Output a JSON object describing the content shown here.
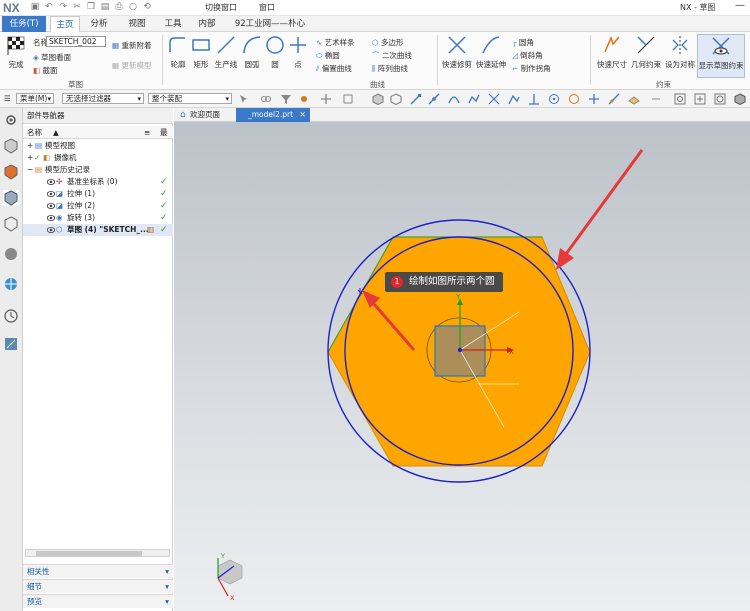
{
  "titlebar": {
    "logo": "NX",
    "switch_window": "切换窗口",
    "window_menu": "窗口",
    "app_title": "NX - 草图"
  },
  "tabs": {
    "task": "任务(T)",
    "items": [
      "主页",
      "分析",
      "视图",
      "工具",
      "内部",
      "92工业网——朴心"
    ],
    "active": "主页"
  },
  "ribbon": {
    "finish": "完成",
    "name_label": "名称",
    "sketch_name": "SKETCH_002",
    "sketch_plane": "草图看面",
    "section": "截面",
    "reattach": "重新附着",
    "update_model": "更新模型",
    "group_sketch": "草图",
    "profile": "轮廓",
    "rectangle": "矩形",
    "line": "生产线",
    "arc": "圆弧",
    "circle": "圆",
    "point": "点",
    "studio_spline": "艺术样条",
    "ellipse": "椭圆",
    "offset_curve": "偏置曲线",
    "polygon": "多边形",
    "conic": "二次曲线",
    "pattern_curve": "阵列曲线",
    "group_curve": "曲线",
    "quick_trim": "快速修剪",
    "quick_extend": "快速延伸",
    "fillet": "圆角",
    "chamfer": "倒斜角",
    "make_corner": "制作拐角",
    "rapid_dimension": "快速尺寸",
    "geometric_constraints": "几何约束",
    "make_symmetric": "设为对称",
    "show_sketch_constraints": "显示草图约束",
    "group_constraint": "约束"
  },
  "cmdbar": {
    "menu": "菜单(M)",
    "filter": "无选择过滤器",
    "assembly_scope": "整个装配"
  },
  "navigator": {
    "title": "部件导航器",
    "col_name": "名称",
    "col_latest": "最",
    "rows": [
      {
        "label": "模型视图",
        "check": false
      },
      {
        "label": "摄像机",
        "check": true
      },
      {
        "label": "模型历史记录",
        "check": false
      },
      {
        "label": "基准坐标系 (0)",
        "check": true
      },
      {
        "label": "拉伸 (1)",
        "check": true
      },
      {
        "label": "拉伸 (2)",
        "check": true
      },
      {
        "label": "旋转 (3)",
        "check": true
      },
      {
        "label": "草图 (4) \"SKETCH_...",
        "check": true
      }
    ],
    "check_mark": "✓",
    "panels": [
      "相关性",
      "细节",
      "预览"
    ]
  },
  "doctabs": {
    "welcome": "欢迎页面",
    "model": "_model2.prt"
  },
  "viewport": {
    "callout_number": "1",
    "callout_text": "绘制如图所示两个圆",
    "axis_x": "X",
    "axis_y": "Y",
    "triad_x": "X",
    "triad_y": "Y",
    "colors": {
      "part_fill": "#FFA500",
      "circle": "#1f1fc8",
      "arrow": "#e63a3a",
      "axis_x": "#d02020",
      "axis_y": "#20a020",
      "axis_z": "#2020d0"
    }
  }
}
